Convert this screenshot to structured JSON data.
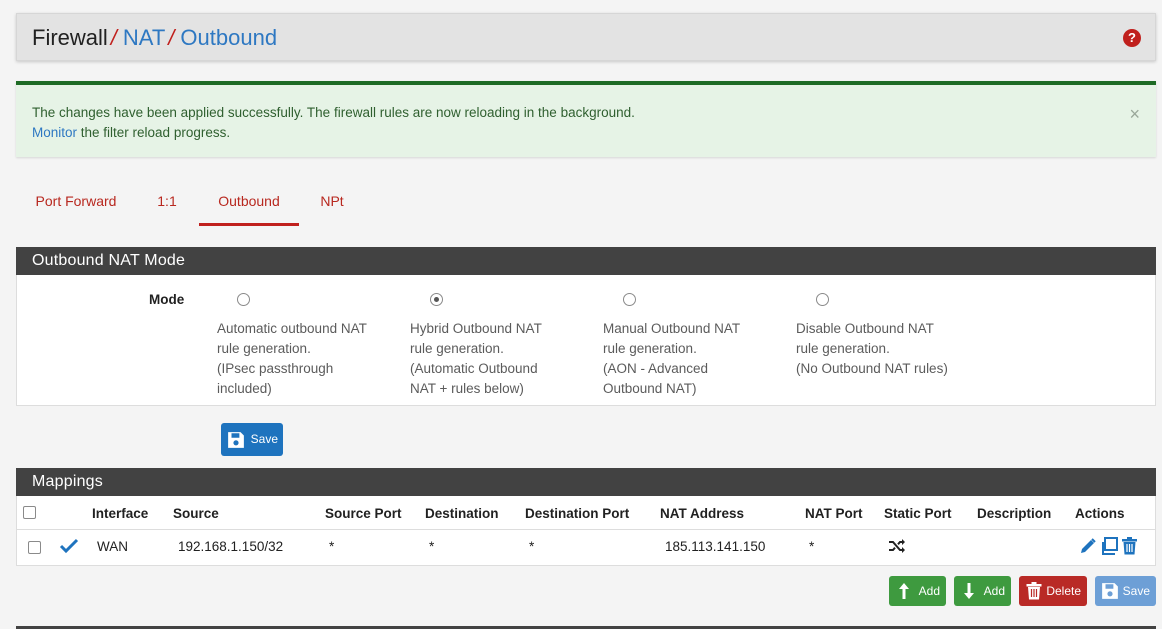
{
  "breadcrumb": {
    "root": "Firewall",
    "items": [
      "NAT",
      "Outbound"
    ],
    "separator": "/"
  },
  "help_icon": "question-circle-icon",
  "alert": {
    "line1": "The changes have been applied successfully. The firewall rules are now reloading in the background.",
    "link": "Monitor",
    "line2_rest": " the filter reload progress.",
    "close": "×"
  },
  "tabs": [
    {
      "label": "Port Forward",
      "active": false
    },
    {
      "label": "1:1",
      "active": false
    },
    {
      "label": "Outbound",
      "active": true
    },
    {
      "label": "NPt",
      "active": false
    }
  ],
  "mode_panel": {
    "heading": "Outbound NAT Mode",
    "label": "Mode",
    "options": [
      {
        "desc": "Automatic outbound NAT\nrule generation.\n(IPsec passthrough\nincluded)",
        "checked": false
      },
      {
        "desc": "Hybrid Outbound NAT\nrule generation.\n(Automatic Outbound\nNAT + rules below)",
        "checked": true
      },
      {
        "desc": "Manual Outbound NAT\nrule generation.\n(AON - Advanced\nOutbound NAT)",
        "checked": false
      },
      {
        "desc": "Disable Outbound NAT\nrule generation.\n(No Outbound NAT rules)",
        "checked": false
      }
    ],
    "save_label": "Save"
  },
  "mappings": {
    "heading": "Mappings",
    "columns": [
      "Interface",
      "Source",
      "Source Port",
      "Destination",
      "Destination Port",
      "NAT Address",
      "NAT Port",
      "Static Port",
      "Description",
      "Actions"
    ],
    "rows": [
      {
        "interface": "WAN",
        "source": "192.168.1.150/32",
        "source_port": "*",
        "destination": "*",
        "destination_port": "*",
        "nat_address": "185.113.141.150",
        "nat_port": "*",
        "static_port_icon": "shuffle-icon",
        "description": ""
      }
    ]
  },
  "actions": {
    "add_top": "Add",
    "add_bottom": "Add",
    "delete": "Delete",
    "save": "Save"
  },
  "colors": {
    "accent_red": "#c0201d",
    "link_blue": "#2e78c2",
    "panel_dark": "#424242",
    "success_green": "#3e9a3f",
    "alert_bg": "#e6f3e6"
  }
}
